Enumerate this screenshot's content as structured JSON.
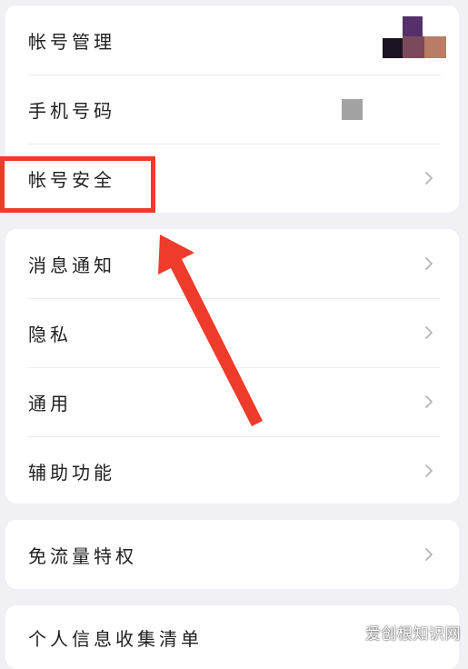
{
  "account_section": {
    "items": [
      {
        "label": "帐号管理"
      },
      {
        "label": "手机号码"
      },
      {
        "label": "帐号安全"
      }
    ]
  },
  "settings_section": {
    "items": [
      {
        "label": "消息通知"
      },
      {
        "label": "隐私"
      },
      {
        "label": "通用"
      },
      {
        "label": "辅助功能"
      }
    ]
  },
  "data_section": {
    "items": [
      {
        "label": "免流量特权"
      }
    ]
  },
  "privacy_section": {
    "items": [
      {
        "label": "个人信息收集清单"
      }
    ]
  },
  "annotation": {
    "color": "#ee3b2b"
  },
  "watermark": {
    "text": "爱创根知识网"
  }
}
